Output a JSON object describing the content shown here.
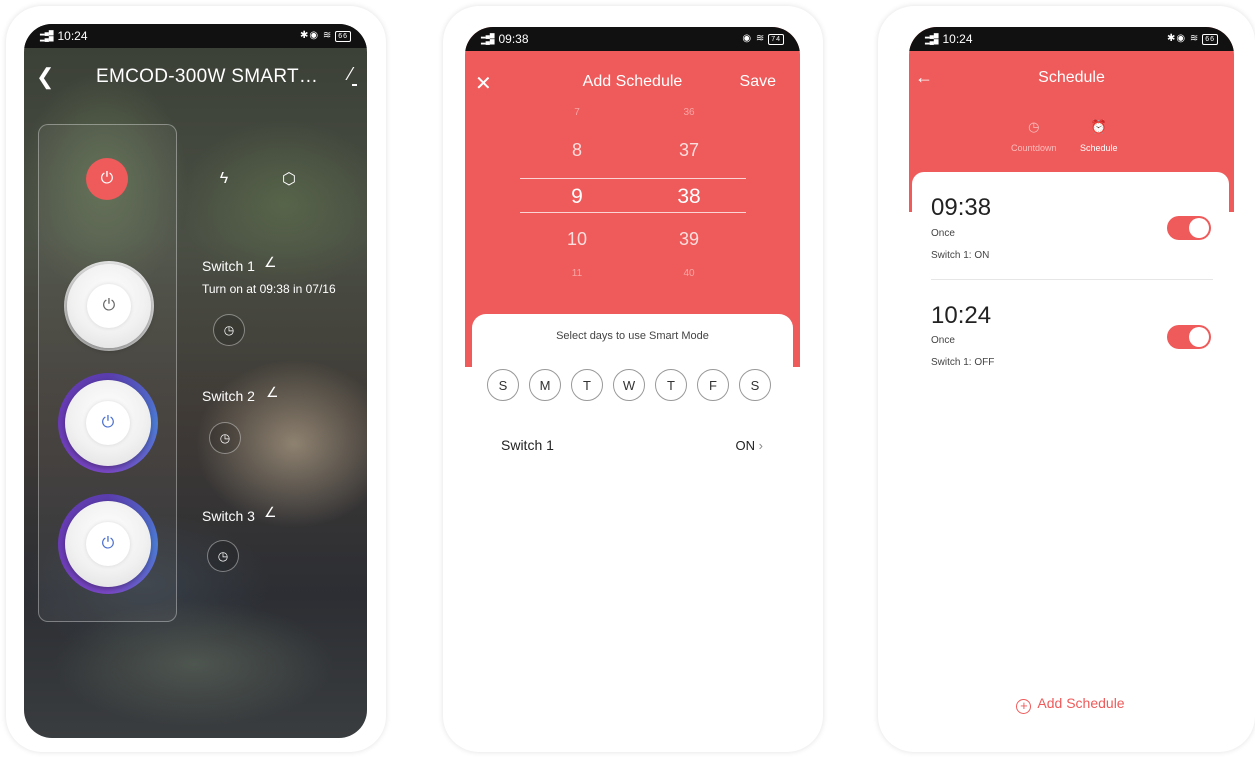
{
  "screen1": {
    "status": {
      "time": "10:24",
      "signal": "4G",
      "battery": "66"
    },
    "title": "EMCOD-300W SMART…",
    "switches": [
      {
        "label": "Switch 1",
        "schedule_text": "Turn on at 09:38 in 07/16"
      },
      {
        "label": "Switch 2",
        "schedule_text": ""
      },
      {
        "label": "Switch 3",
        "schedule_text": ""
      }
    ]
  },
  "screen2": {
    "status": {
      "time": "09:38",
      "signal": "4G",
      "battery": "74"
    },
    "title": "Add Schedule",
    "save_label": "Save",
    "hours": [
      "7",
      "8",
      "9",
      "10",
      "11"
    ],
    "minutes": [
      "36",
      "37",
      "38",
      "39",
      "40"
    ],
    "days_hint": "Select days to use Smart Mode",
    "days": [
      "S",
      "M",
      "T",
      "W",
      "T",
      "F",
      "S"
    ],
    "switch_row": {
      "label": "Switch 1",
      "value": "ON"
    }
  },
  "screen3": {
    "status": {
      "time": "10:24",
      "signal": "4G",
      "battery": "66"
    },
    "title": "Schedule",
    "tabs": [
      {
        "label": "Countdown"
      },
      {
        "label": "Schedule"
      }
    ],
    "items": [
      {
        "time": "09:38",
        "repeat": "Once",
        "action": "Switch 1: ON",
        "enabled": true
      },
      {
        "time": "10:24",
        "repeat": "Once",
        "action": "Switch 1: OFF",
        "enabled": true
      }
    ],
    "add_label": "Add Schedule"
  },
  "colors": {
    "accent": "#ef5a5a",
    "knob_ring": "#5a3dad"
  }
}
